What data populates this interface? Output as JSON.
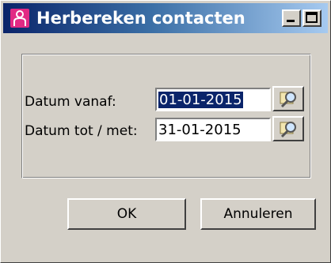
{
  "window": {
    "title": "Herbereken contacten",
    "title_icon": "user-icon",
    "accent_color": "#e22a84",
    "titlebar_color": "#0a246a"
  },
  "form": {
    "from_label": "Datum vanaf:",
    "from_value": "01-01-2015",
    "to_label": "Datum tot / met:",
    "to_value": "31-01-2015",
    "picker_icon": "magnifier-icon"
  },
  "buttons": {
    "ok_label": "OK",
    "cancel_label": "Annuleren"
  }
}
